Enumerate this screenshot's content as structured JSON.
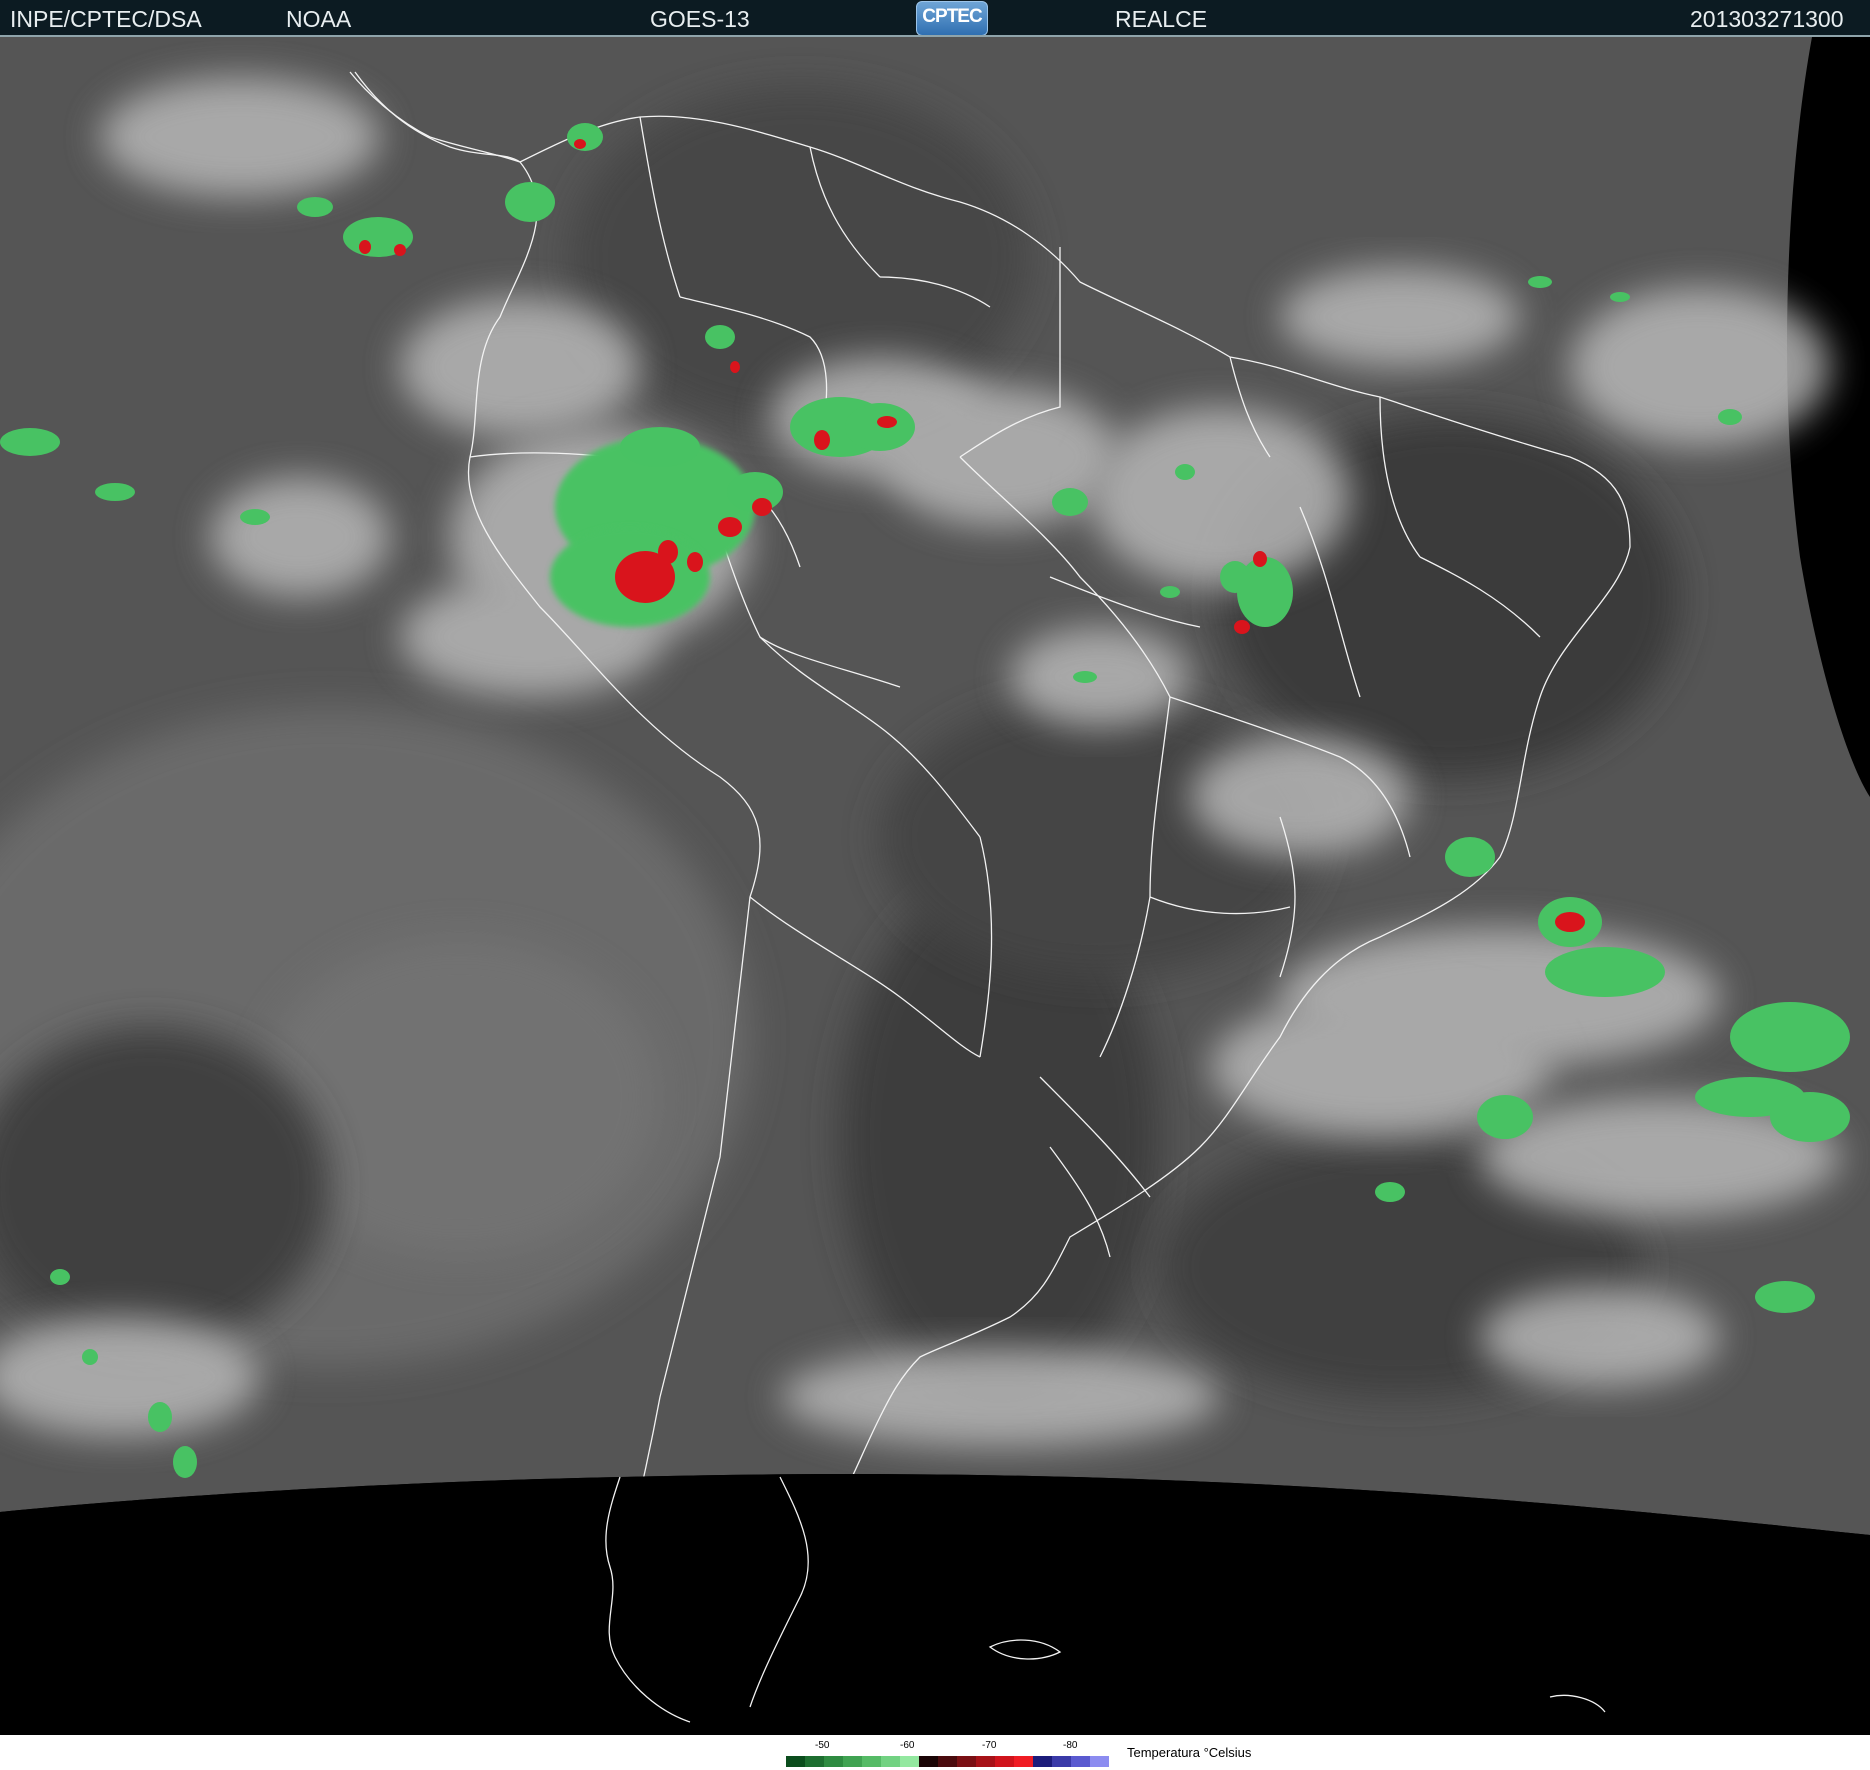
{
  "header": {
    "agency": "INPE/CPTEC/DSA",
    "partner": "NOAA",
    "satellite": "GOES-13",
    "logo_text": "CPTEC",
    "product": "REALCE",
    "timestamp": "201303271300"
  },
  "legend": {
    "title": "Temperatura °Celsius",
    "ticks": [
      "-50",
      "-60",
      "-70",
      "-80"
    ],
    "colors": [
      "#0b4d1d",
      "#1d6e30",
      "#2e8b41",
      "#40a352",
      "#55bb66",
      "#72d282",
      "#93e8a0",
      "#1a0506",
      "#4a0b0e",
      "#7a1014",
      "#a71218",
      "#d0141c",
      "#f01c24",
      "#1c1c7a",
      "#3a3aa8",
      "#5a5ad0",
      "#8c8cf0"
    ]
  }
}
